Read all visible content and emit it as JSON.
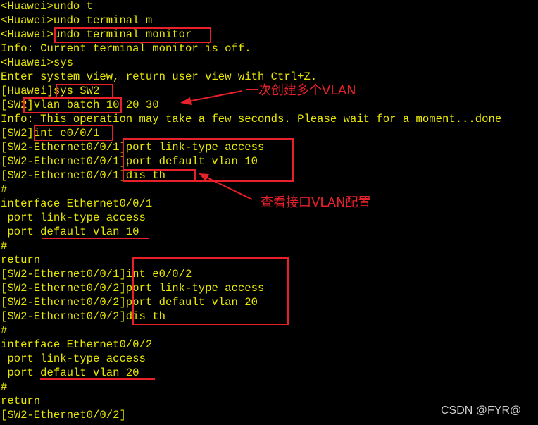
{
  "terminal": {
    "lines": [
      "<Huawei>undo t",
      "<Huawei>undo terminal m",
      "<Huawei>undo terminal monitor",
      "Info: Current terminal monitor is off.",
      "<Huawei>sys",
      "Enter system view, return user view with Ctrl+Z.",
      "[Huawei]sys SW2",
      "[SW2]vlan batch 10 20 30",
      "Info: This operation may take a few seconds. Please wait for a moment...done",
      "[SW2]int e0/0/1",
      "[SW2-Ethernet0/0/1]port link-type access",
      "[SW2-Ethernet0/0/1]port default vlan 10",
      "[SW2-Ethernet0/0/1]dis th",
      "#",
      "interface Ethernet0/0/1",
      " port link-type access",
      " port default vlan 10",
      "#",
      "return",
      "[SW2-Ethernet0/0/1]int e0/0/2",
      "[SW2-Ethernet0/0/2]port link-type access",
      "[SW2-Ethernet0/0/2]port default vlan 20",
      "[SW2-Ethernet0/0/2]dis th",
      "#",
      "interface Ethernet0/0/2",
      " port link-type access",
      " port default vlan 20",
      "#",
      "return",
      "[SW2-Ethernet0/0/2]"
    ]
  },
  "annotations": {
    "batch_vlan_note": "一次创建多个VLAN",
    "view_config_note": "查看接口VLAN配置",
    "highlight_color": "#e8202a",
    "text_color": "#e8e800"
  },
  "watermark": "CSDN @FYR@"
}
